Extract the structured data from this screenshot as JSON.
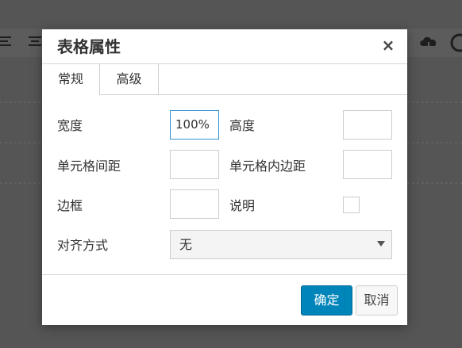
{
  "dialog": {
    "title": "表格属性",
    "close_icon": "×"
  },
  "tabs": [
    {
      "label": "常规",
      "active": true
    },
    {
      "label": "高级",
      "active": false
    }
  ],
  "fields": {
    "width": {
      "label": "宽度",
      "value": "100%"
    },
    "height": {
      "label": "高度",
      "value": ""
    },
    "cell_spacing": {
      "label": "单元格间距",
      "value": ""
    },
    "cell_padding": {
      "label": "单元格内边距",
      "value": ""
    },
    "border": {
      "label": "边框",
      "value": ""
    },
    "caption": {
      "label": "说明",
      "checked": false
    },
    "alignment": {
      "label": "对齐方式",
      "selected": "无"
    }
  },
  "buttons": {
    "ok": "确定",
    "cancel": "取消"
  },
  "background_toolbar": {
    "icons": [
      "align-left-icon",
      "align-center-icon",
      "cloud-download-icon",
      "wordpress-icon"
    ]
  },
  "colors": {
    "primary_button": "#0085ba",
    "focus_border": "#2e8fd3",
    "overlay": "#555555"
  }
}
